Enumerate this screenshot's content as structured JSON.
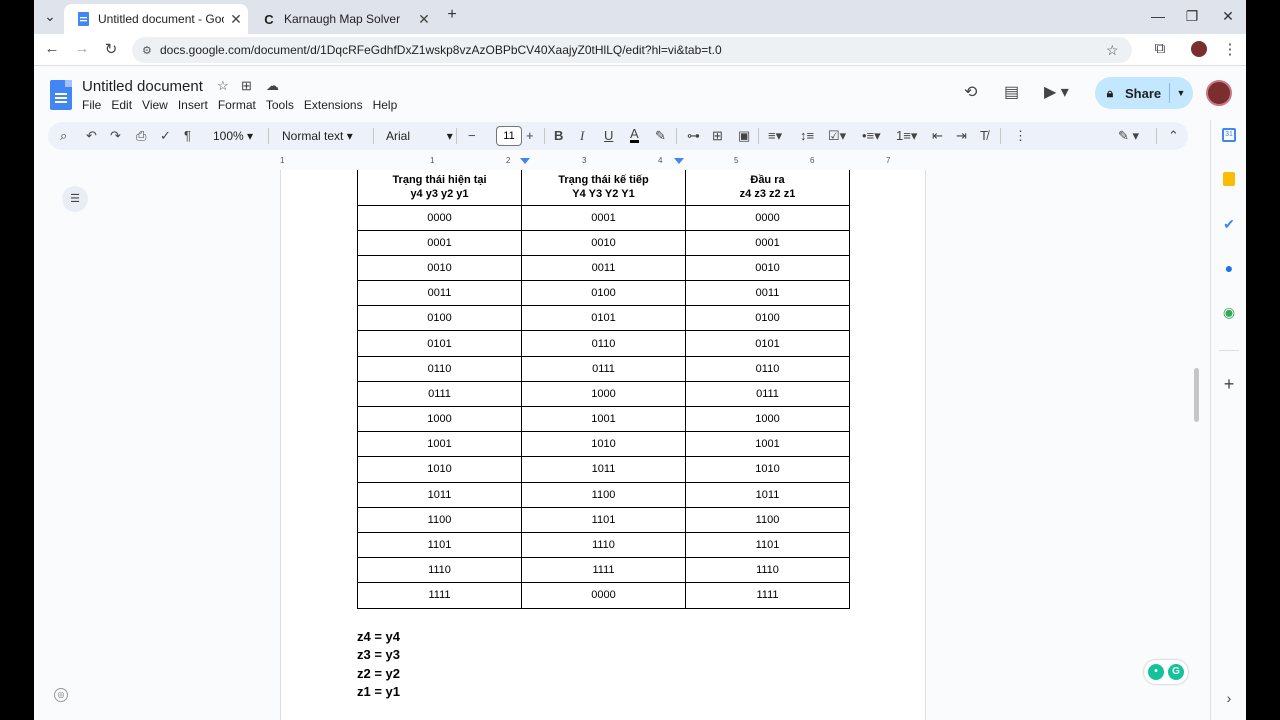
{
  "browser": {
    "tabs": [
      {
        "title": "Untitled document - Google Do",
        "active": true
      },
      {
        "title": "Karnaugh Map Solver",
        "active": false
      }
    ],
    "url": "docs.google.com/document/d/1DqcRFeGdhfDxZ1wskp8vzAzOBPbCV40XaajyZ0tHlLQ/edit?hl=vi&tab=t.0"
  },
  "docs": {
    "title": "Untitled document",
    "menu": [
      "File",
      "Edit",
      "View",
      "Insert",
      "Format",
      "Tools",
      "Extensions",
      "Help"
    ],
    "share_label": "Share"
  },
  "toolbar": {
    "zoom": "100%",
    "style": "Normal text",
    "font": "Arial",
    "font_size": "11"
  },
  "ruler": [
    "1",
    "1",
    "2",
    "3",
    "4",
    "5",
    "6",
    "7"
  ],
  "table": {
    "headers": [
      [
        "Trạng thái hiện tại",
        "y4 y3 y2 y1"
      ],
      [
        "Trạng thái kế tiếp",
        "Y4 Y3 Y2 Y1"
      ],
      [
        "Đầu ra",
        "z4 z3 z2 z1"
      ]
    ],
    "rows": [
      [
        "0000",
        "0001",
        "0000"
      ],
      [
        "0001",
        "0010",
        "0001"
      ],
      [
        "0010",
        "0011",
        "0010"
      ],
      [
        "0011",
        "0100",
        "0011"
      ],
      [
        "0100",
        "0101",
        "0100"
      ],
      [
        "0101",
        "0110",
        "0101"
      ],
      [
        "0110",
        "0111",
        "0110"
      ],
      [
        "0111",
        "1000",
        "0111"
      ],
      [
        "1000",
        "1001",
        "1000"
      ],
      [
        "1001",
        "1010",
        "1001"
      ],
      [
        "1010",
        "1011",
        "1010"
      ],
      [
        "1011",
        "1100",
        "1011"
      ],
      [
        "1100",
        "1101",
        "1100"
      ],
      [
        "1101",
        "1110",
        "1101"
      ],
      [
        "1110",
        "1111",
        "1110"
      ],
      [
        "1111",
        "0000",
        "1111"
      ]
    ]
  },
  "equations": [
    "z4 = y4",
    "z3 = y3",
    "z2 = y2",
    "z1 = y1"
  ],
  "colors": {
    "accent": "#4285f4",
    "share_bg": "#c2e7ff",
    "toolbar_bg": "#edf2fa"
  }
}
